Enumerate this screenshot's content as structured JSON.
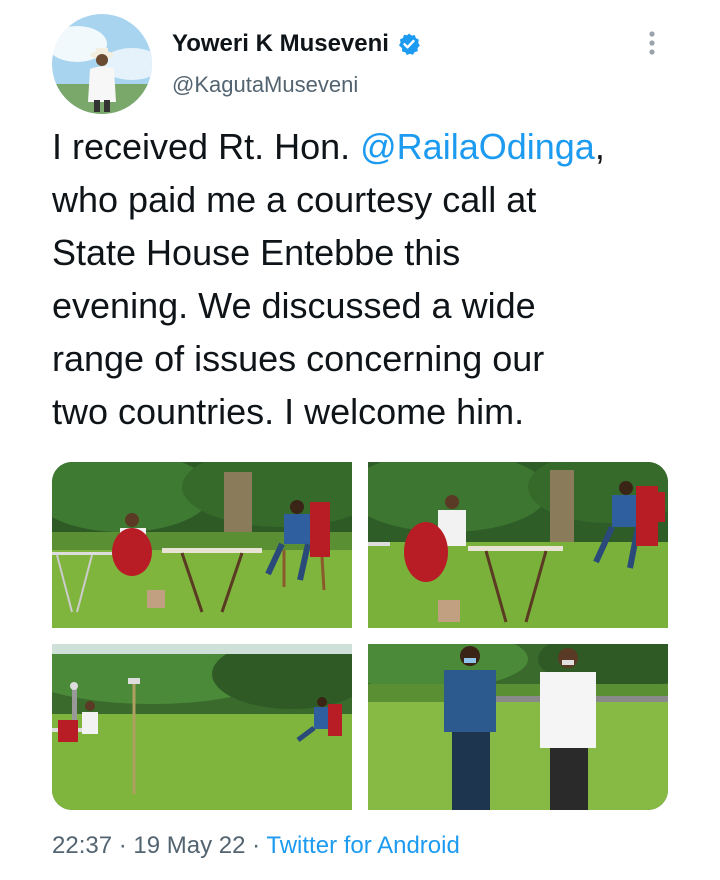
{
  "tweet": {
    "author_name": "Yoweri K Museveni",
    "handle": "@KagutaMuseveni",
    "verified": true,
    "text_before_mention": "I received Rt. Hon. ",
    "mention": "@RailaOdinga",
    "text_after_mention": ",\nwho paid me a courtesy call at\nState House Entebbe this\nevening. We discussed a wide\nrange of issues concerning our\ntwo countries. I welcome him.",
    "time": "22:37",
    "separator": "·",
    "date": "19 May 22",
    "source": "Twitter for Android"
  },
  "icons": {
    "verified": "verified-badge-icon",
    "more": "more-options-icon"
  },
  "colors": {
    "accent": "#1d9bf0",
    "secondary_text": "#536471",
    "primary_text": "#0f1419"
  },
  "media": [
    {
      "description": "photo-1"
    },
    {
      "description": "photo-2"
    },
    {
      "description": "photo-3"
    },
    {
      "description": "photo-4"
    }
  ]
}
